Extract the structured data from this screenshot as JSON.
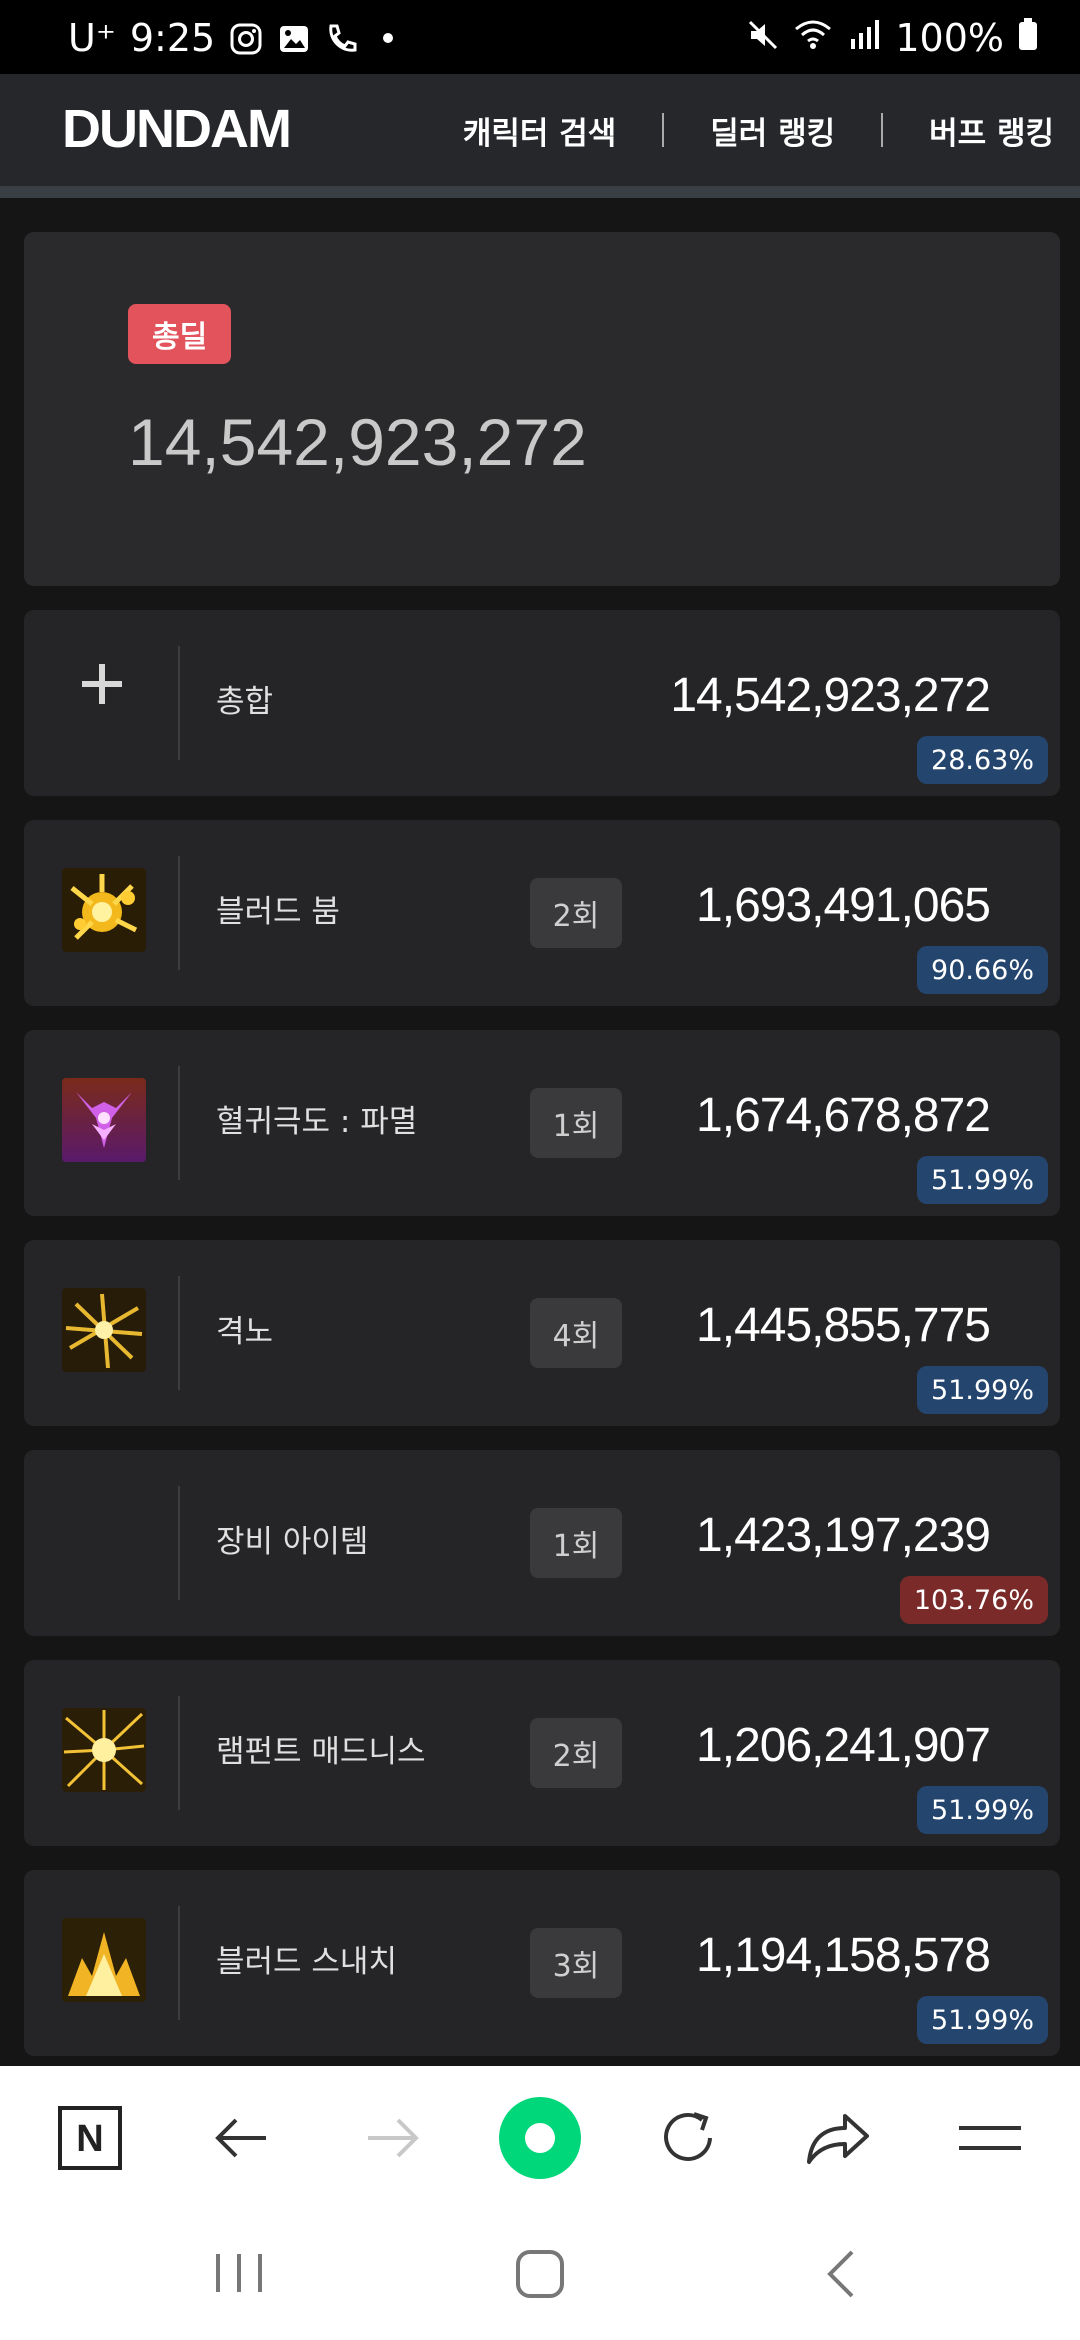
{
  "status_bar": {
    "carrier": "U⁺",
    "time": "9:25",
    "battery": "100%"
  },
  "header": {
    "logo": "DUNDAM",
    "nav": [
      "캐릭터 검색",
      "딜러 랭킹",
      "버프 랭킹"
    ]
  },
  "total": {
    "badge": "총딜",
    "value": "14,542,923,272"
  },
  "rows": [
    {
      "name": "총합",
      "count": "",
      "damage": "14,542,923,272",
      "percent": "28.63%",
      "icon": "plus-icon",
      "percent_color": "#24466e"
    },
    {
      "name": "블러드 붐",
      "count": "2회",
      "damage": "1,693,491,065",
      "percent": "90.66%",
      "icon": "blood-boom-skill-icon",
      "percent_color": "#24466e"
    },
    {
      "name": "혈귀극도 : 파멸",
      "count": "1회",
      "damage": "1,674,678,872",
      "percent": "51.99%",
      "icon": "blood-demon-skill-icon",
      "percent_color": "#24466e"
    },
    {
      "name": "격노",
      "count": "4회",
      "damage": "1,445,855,775",
      "percent": "51.99%",
      "icon": "fury-skill-icon",
      "percent_color": "#24466e"
    },
    {
      "name": "장비 아이템",
      "count": "1회",
      "damage": "1,423,197,239",
      "percent": "103.76%",
      "icon": "",
      "percent_color": "#7a2a28"
    },
    {
      "name": "램펀트 매드니스",
      "count": "2회",
      "damage": "1,206,241,907",
      "percent": "51.99%",
      "icon": "rampant-madness-skill-icon",
      "percent_color": "#24466e"
    },
    {
      "name": "블러드 스내치",
      "count": "3회",
      "damage": "1,194,158,578",
      "percent": "51.99%",
      "icon": "blood-snatch-skill-icon",
      "percent_color": "#24466e"
    }
  ],
  "toolbar": {
    "home_letter": "N",
    "accent": "#00d67a"
  }
}
